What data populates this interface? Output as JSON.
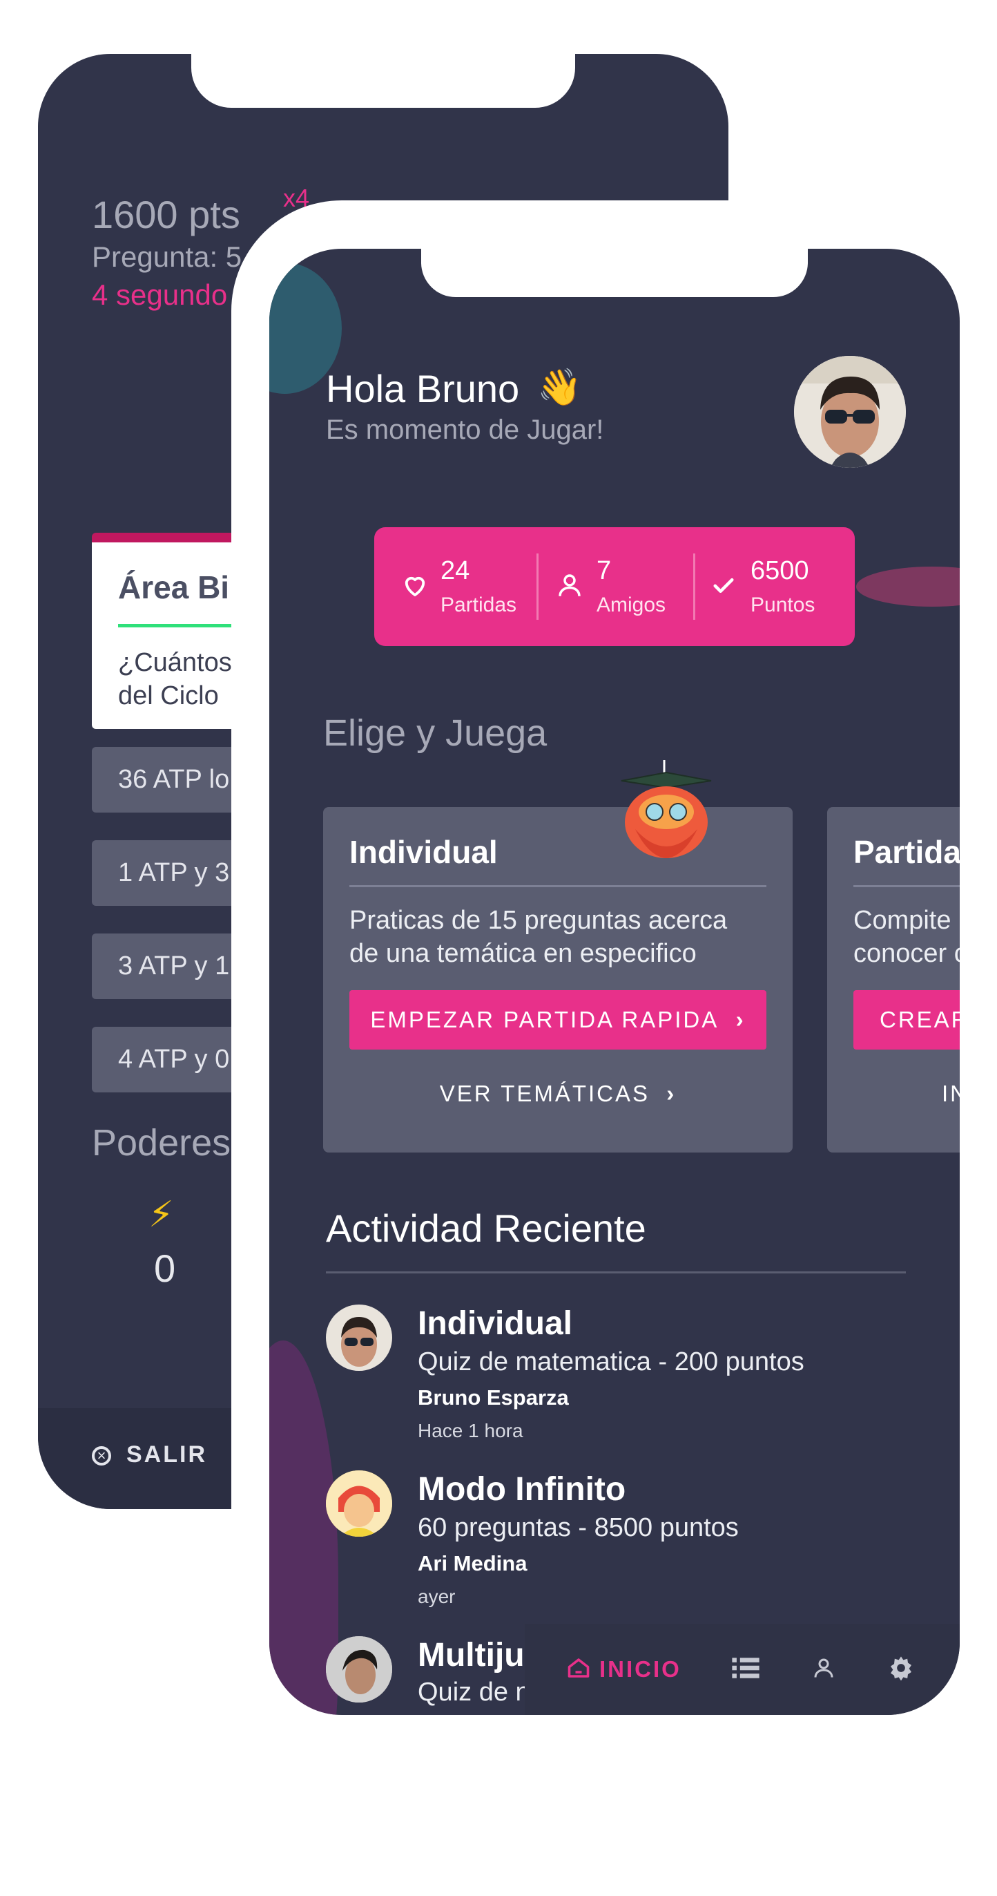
{
  "back_screen": {
    "points": "1600 pts",
    "multiplier": "x4",
    "question_progress": "Pregunta: 5",
    "time_left": "4 segundo",
    "card_area": "Área Bi",
    "card_question_line1": "¿Cuántos",
    "card_question_line2": "del Ciclo",
    "options": [
      "36 ATP lo",
      "1 ATP y 3",
      "3 ATP y 1",
      "4 ATP y  0"
    ],
    "powers_title": "Poderes",
    "power_bolt_count": "0",
    "exit_label": "SALIR"
  },
  "front_screen": {
    "greeting": "Hola Bruno",
    "greeting_emoji": "👋",
    "subtitle": "Es momento de Jugar!",
    "stats": [
      {
        "icon": "heart-icon",
        "value": "24",
        "label": "Partidas"
      },
      {
        "icon": "user-icon",
        "value": "7",
        "label": "Amigos"
      },
      {
        "icon": "check-icon",
        "value": "6500",
        "label": "Puntos"
      }
    ],
    "section_title": "Elige y Juega",
    "modes": [
      {
        "title": "Individual",
        "description": "Praticas de 15 preguntas acerca de una temática en especifico",
        "primary_button": "EMPEZAR PARTIDA RAPIDA",
        "secondary_link": "VER TEMÁTICAS"
      },
      {
        "title": "Partida",
        "description": "Compite conocer c",
        "primary_button": "CREAR",
        "secondary_link": "IN"
      }
    ],
    "activity_title": "Actividad Reciente",
    "activity": [
      {
        "title": "Individual",
        "detail": "Quiz de matematica - 200 puntos",
        "user": "Bruno Esparza",
        "time": "Hace 1 hora"
      },
      {
        "title": "Modo Infinito",
        "detail": "60 preguntas - 8500 puntos",
        "user": "Ari Medina",
        "time": "ayer"
      },
      {
        "title": "Multiju",
        "detail": "Quiz de n",
        "user": "",
        "time": ""
      }
    ],
    "nav": {
      "home_label": "INICIO"
    }
  },
  "colors": {
    "accent": "#e8308a",
    "background": "#31344a",
    "card": "#5a5d71"
  }
}
